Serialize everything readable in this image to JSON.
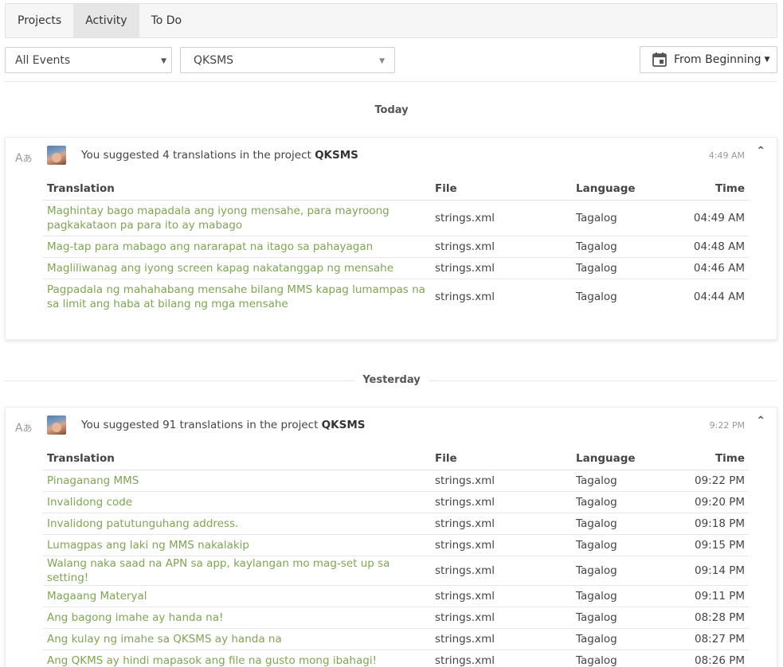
{
  "tabs": [
    "Projects",
    "Activity",
    "To Do"
  ],
  "filters": {
    "events": "All Events",
    "project": "QKSMS",
    "date": "From Beginning"
  },
  "headers": {
    "translation": "Translation",
    "file": "File",
    "language": "Language",
    "time": "Time"
  },
  "groups": [
    {
      "label": "Today",
      "summary_prefix": "You suggested 4 translations in the project",
      "project": "QKSMS",
      "time": "4:49 AM",
      "rows": [
        {
          "text": "Maghintay bago mapadala ang iyong mensahe, para mayroong pagkakataon pa para ito ay mabago",
          "file": "strings.xml",
          "language": "Tagalog",
          "time": "04:49 AM"
        },
        {
          "text": "Mag-tap para mabago ang nararapat na itago sa pahayagan",
          "file": "strings.xml",
          "language": "Tagalog",
          "time": "04:48 AM"
        },
        {
          "text": "Magliliwanag ang iyong screen kapag nakatanggap ng mensahe",
          "file": "strings.xml",
          "language": "Tagalog",
          "time": "04:46 AM"
        },
        {
          "text": "Pagpadala ng mahahabang mensahe bilang MMS kapag lumampas na sa limit ang haba at bilang ng mga mensahe",
          "file": "strings.xml",
          "language": "Tagalog",
          "time": "04:44 AM"
        }
      ]
    },
    {
      "label": "Yesterday",
      "summary_prefix": "You suggested 91 translations in the project",
      "project": "QKSMS",
      "time": "9:22 PM",
      "rows": [
        {
          "text": "Pinaganang MMS",
          "file": "strings.xml",
          "language": "Tagalog",
          "time": "09:22 PM"
        },
        {
          "text": "Invalidong code",
          "file": "strings.xml",
          "language": "Tagalog",
          "time": "09:20 PM"
        },
        {
          "text": "Invalidong patutunguhang address.",
          "file": "strings.xml",
          "language": "Tagalog",
          "time": "09:18 PM"
        },
        {
          "text": "Lumagpas ang laki ng MMS nakalakip",
          "file": "strings.xml",
          "language": "Tagalog",
          "time": "09:15 PM"
        },
        {
          "text": "Walang naka saad na APN sa app, kaylangan mo mag-set up sa setting!",
          "file": "strings.xml",
          "language": "Tagalog",
          "time": "09:14 PM"
        },
        {
          "text": "Magaang Materyal",
          "file": "strings.xml",
          "language": "Tagalog",
          "time": "09:11 PM"
        },
        {
          "text": "Ang bagong imahe ay handa na!",
          "file": "strings.xml",
          "language": "Tagalog",
          "time": "08:28 PM"
        },
        {
          "text": "Ang kulay ng imahe sa QKSMS ay handa na",
          "file": "strings.xml",
          "language": "Tagalog",
          "time": "08:27 PM"
        },
        {
          "text": "Ang QKMS ay hindi mapasok ang file na gusto mong ibahagi!",
          "file": "strings.xml",
          "language": "Tagalog",
          "time": "08:26 PM"
        }
      ]
    }
  ]
}
